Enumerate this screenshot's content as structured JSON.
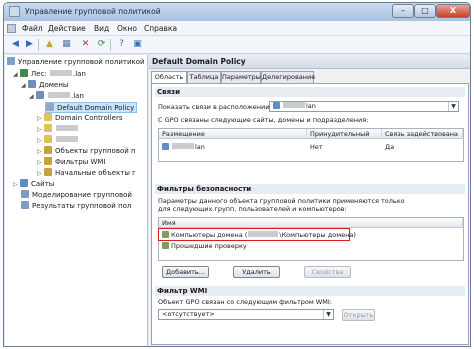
{
  "window": {
    "title": "Управление групповой политикой",
    "buttons": {
      "minimize": "–",
      "maximize": "□",
      "close": "X"
    }
  },
  "menu": [
    "Файл",
    "Действие",
    "Вид",
    "Окно",
    "Справка"
  ],
  "toolbar_icons": [
    "back-arrow-icon",
    "forward-arrow-icon",
    "folder-up-icon",
    "details-icon",
    "delete-icon",
    "refresh-icon",
    "help-icon",
    "console-icon"
  ],
  "tree": {
    "root": "Управление групповой политикой",
    "forest_prefix": "Лес:",
    "forest_suffix": ".lan",
    "domains": "Домены",
    "domain_suffix": ".lan",
    "items": [
      "Default Domain Policy",
      "Domain Controllers",
      "Объекты групповой п",
      "Фильтры WMI",
      "Начальные объекты г"
    ],
    "ou_placeholders": 2,
    "sites": "Сайты",
    "modeling": "Моделирование групповой",
    "results": "Результаты групповой пол"
  },
  "policy": {
    "title": "Default Domain Policy",
    "tabs": [
      "Область",
      "Таблица",
      "Параметры",
      "Делегирование"
    ],
    "links": {
      "heading": "Связи",
      "show_label": "Показать связи в расположении:",
      "location_suffix": "lan",
      "description": "С GPO связаны следующие сайты, домены и подразделения:",
      "columns": [
        "Размещение",
        "Принудительный",
        "Связь задействована"
      ],
      "rows": [
        {
          "location_suffix": "lan",
          "enforced": "Нет",
          "link_enabled": "Да"
        }
      ]
    },
    "security": {
      "heading": "Фильтры безопасности",
      "description_line1": "Параметры данного объекта групповой политики применяются только",
      "description_line2": "для следующих групп, пользователей и компьютеров:",
      "column": "Имя",
      "rows": [
        {
          "prefix": "Компьютеры домена (",
          "suffix": "\\Компьютеры домена)",
          "highlighted": true
        },
        {
          "prefix": "Прошедшие проверку",
          "suffix": "",
          "highlighted": false
        }
      ],
      "buttons": {
        "add": "Добавить...",
        "remove": "Удалить",
        "properties": "Свойства"
      }
    },
    "wmi": {
      "heading": "Фильтр WMI",
      "description": "Объект GPO связан со следующим фильтром WMI:",
      "value": "<отсутствует>",
      "open_button": "Открыть"
    }
  },
  "colors": {
    "highlight": "#d81b24",
    "selection": "#cce4f7",
    "titlebar": "#aac3e3"
  }
}
